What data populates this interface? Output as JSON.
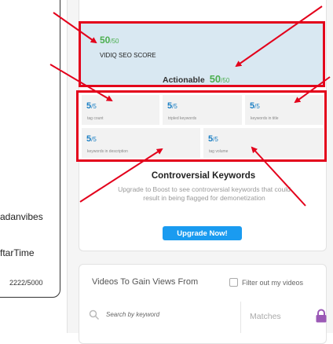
{
  "editor": {
    "tags": [
      "adanvibes",
      "ftarTime"
    ],
    "char_count": "2222/5000"
  },
  "seo": {
    "score": "50",
    "max": "/50",
    "label": "VIDIQ SEO SCORE",
    "actionable_label": "Actionable",
    "actionable_score": "50",
    "actionable_max": "/50"
  },
  "metrics": [
    {
      "score": "5",
      "max": "/5",
      "label": "tag count"
    },
    {
      "score": "5",
      "max": "/5",
      "label": "tripled keywords"
    },
    {
      "score": "5",
      "max": "/5",
      "label": "keywords in title"
    },
    {
      "score": "5",
      "max": "/5",
      "label": "keywords in description"
    },
    {
      "score": "5",
      "max": "/5",
      "label": "tag volume"
    }
  ],
  "controversial": {
    "title": "Controversial Keywords",
    "description": "Upgrade to Boost to see controversial keywords that could result in being flagged for demonetization",
    "button": "Upgrade Now!"
  },
  "videos": {
    "title": "Videos To Gain Views From",
    "filter_label": "Filter out my videos",
    "search_placeholder": "Search by keyword",
    "matches_label": "Matches"
  },
  "colors": {
    "highlight": "#e3001b",
    "score_green": "#4caf50",
    "score_blue": "#1b7fc4",
    "seo_background": "#d9e8f2",
    "button_blue": "#1a9bf0"
  },
  "icons": [
    "search-icon",
    "lock-icon"
  ]
}
